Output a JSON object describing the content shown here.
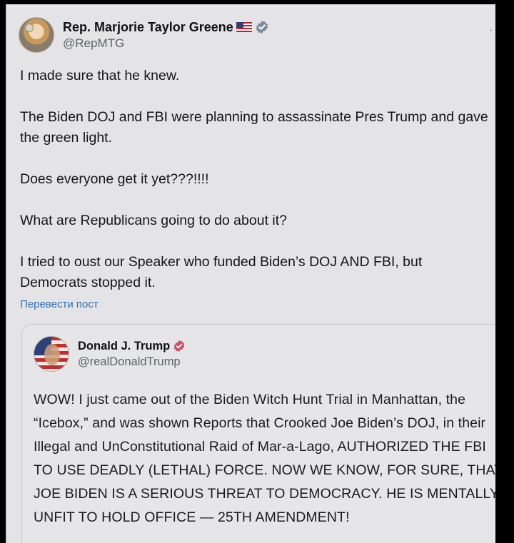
{
  "post": {
    "author": {
      "display_name": "Rep. Marjorie Taylor Greene",
      "flag_icon": "us-flag-icon",
      "verified_color": "#7b8a9c",
      "handle": "@RepMTG"
    },
    "paragraphs": [
      "I made sure that he knew.",
      "The Biden DOJ and FBI were planning to assassinate Pres Trump and gave the green light.",
      "Does everyone get it yet???!!!!",
      "What are Republicans going to do about it?",
      "I tried to oust our Speaker who funded Biden’s DOJ AND FBI, but Democrats stopped it."
    ],
    "translate_link": "Перевести пост",
    "more_indicator": "·"
  },
  "quoted_post": {
    "author": {
      "display_name": "Donald J. Trump",
      "verified_color": "#c8506a",
      "handle": "@realDonaldTrump"
    },
    "text": "WOW! I just came out of the Biden Witch Hunt Trial in Manhattan, the “Icebox,” and was shown Reports that Crooked Joe Biden’s DOJ, in their Illegal and UnConstitutional Raid of Mar-a-Lago, AUTHORIZED THE FBI TO USE DEADLY (LETHAL) FORCE. NOW WE KNOW, FOR SURE, THAT JOE BIDEN IS A SERIOUS THREAT TO DEMOCRACY. HE IS MENTALLY UNFIT TO HOLD OFFICE — 25TH AMENDMENT!"
  },
  "colors": {
    "background": "#e4e4e6",
    "link": "#2d6fb0",
    "text": "#151515",
    "secondary_text": "#5b6168"
  }
}
